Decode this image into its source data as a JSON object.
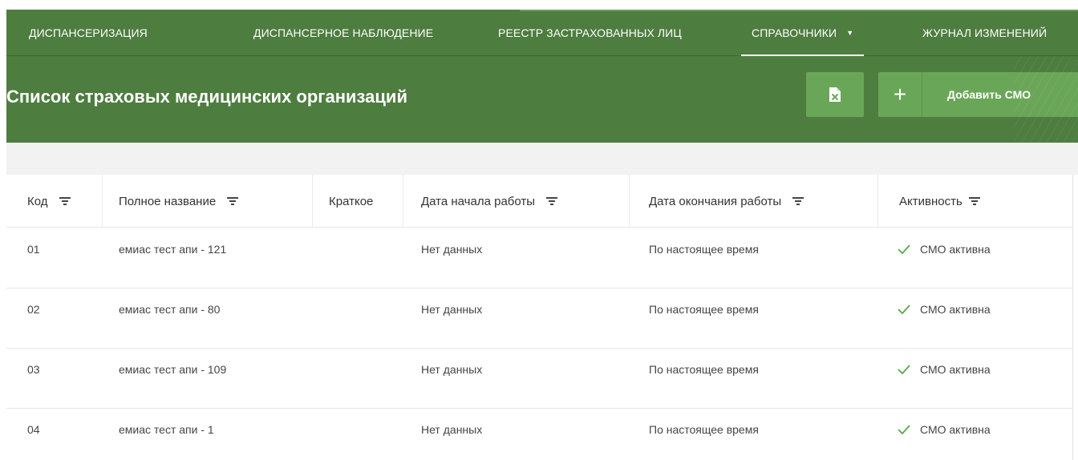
{
  "nav": {
    "items": [
      {
        "label": "ДИСПАНСЕРИЗАЦИЯ"
      },
      {
        "label": "ДИСПАНСЕРНОЕ НАБЛЮДЕНИЕ"
      },
      {
        "label": "РЕЕСТР ЗАСТРАХОВАННЫХ ЛИЦ"
      },
      {
        "label": "СПРАВОЧНИКИ"
      },
      {
        "label": "ЖУРНАЛ ИЗМЕНЕНИЙ"
      }
    ]
  },
  "header": {
    "title": "Список страховых медицинских организаций",
    "add_button_label": "Добавить СМО",
    "add_button_icon": "plus-icon",
    "export_button_icon": "excel-export-icon"
  },
  "table": {
    "columns": [
      {
        "label": "Код"
      },
      {
        "label": "Полное название"
      },
      {
        "label": "Краткое"
      },
      {
        "label": "Дата начала работы"
      },
      {
        "label": "Дата окончания работы"
      },
      {
        "label": "Активность"
      }
    ],
    "rows": [
      {
        "code": "01",
        "full_name": "емиас тест апи - 121",
        "short_name": "",
        "start_date": "Нет данных",
        "end_date": "По настоящее время",
        "activity": "СМО активна"
      },
      {
        "code": "02",
        "full_name": "емиас тест апи - 80",
        "short_name": "",
        "start_date": "Нет данных",
        "end_date": "По настоящее время",
        "activity": "СМО активна"
      },
      {
        "code": "03",
        "full_name": "емиас тест апи - 109",
        "short_name": "",
        "start_date": "Нет данных",
        "end_date": "По настоящее время",
        "activity": "СМО активна"
      },
      {
        "code": "04",
        "full_name": "емиас тест апи - 1",
        "short_name": "",
        "start_date": "Нет данных",
        "end_date": "По настоящее время",
        "activity": "СМО активна"
      }
    ]
  },
  "colors": {
    "brand_green": "#4d7d3f",
    "button_green": "#6aa657",
    "check_green": "#5aa84a"
  }
}
